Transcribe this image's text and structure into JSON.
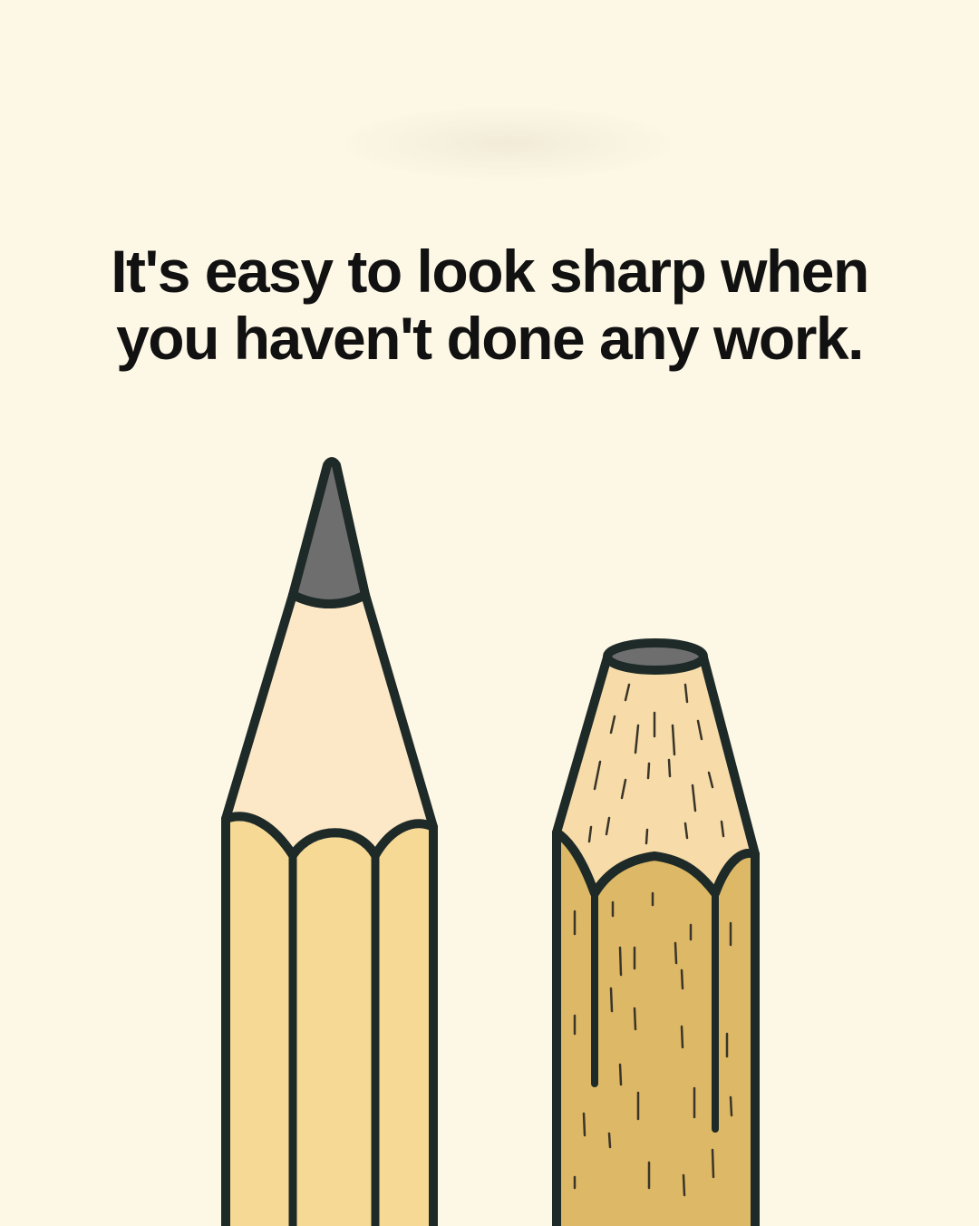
{
  "headline": {
    "line1": "It's easy to look sharp when",
    "line2": "you haven't done any work."
  },
  "illustration": {
    "left_pencil": "sharp-pencil",
    "right_pencil": "worn-pencil"
  },
  "colors": {
    "background": "#fdf7e6",
    "outline": "#1e2a28",
    "graphite": "#6e6e6e",
    "sharp_wood": "#fce8c6",
    "sharp_body": "#f6d995",
    "worn_wood": "#f7dcaa",
    "worn_body": "#ddb866",
    "text": "#111111"
  }
}
